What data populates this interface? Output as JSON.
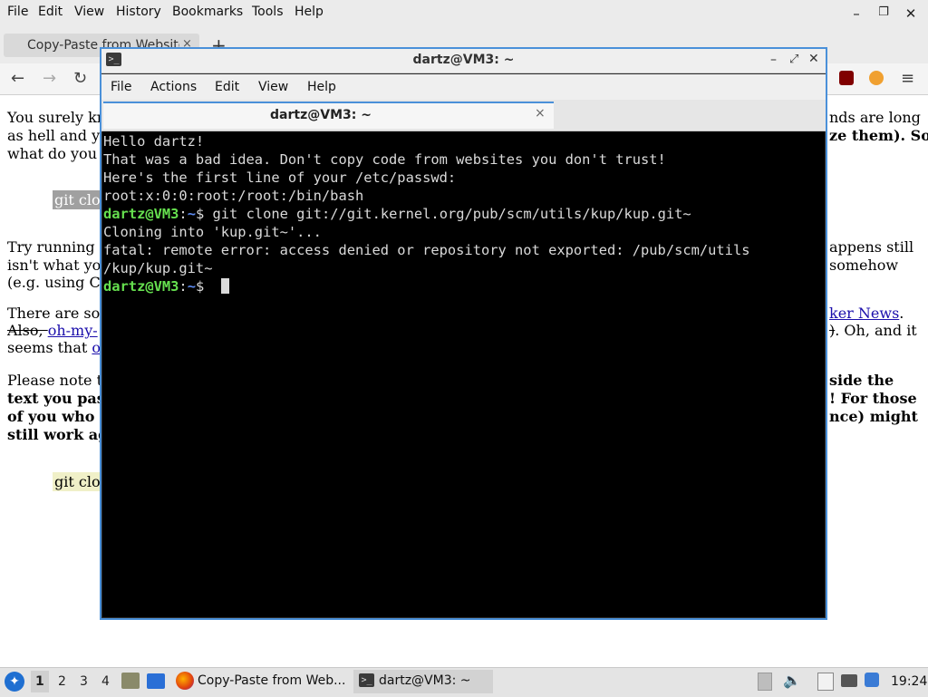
{
  "browser": {
    "menu": [
      "File",
      "Edit",
      "View",
      "History",
      "Bookmarks",
      "Tools",
      "Help"
    ],
    "tab_title": "Copy-Paste from Website",
    "tab_close": "×",
    "new_tab": "+",
    "window_buttons": {
      "minimize": "–",
      "maximize": "❐",
      "close": "✕"
    }
  },
  "page": {
    "p1": [
      "You surely kn",
      "nds are long",
      "as hell and y",
      "ze them). So,",
      "what do you "
    ],
    "code_top": "git clo",
    "p2": [
      "Try running ",
      "appens still",
      "isn't what yo",
      "somehow",
      "(e.g. using C"
    ],
    "p3": {
      "l1_left": "There are so",
      "l1_link": "ker News",
      "l1_end": ".",
      "l2_left": "Also, ",
      "l2_link": "oh-my-",
      "l2_right_strike": ")",
      "l2_right": ". Oh, and it",
      "l3_left": "seems that ",
      "l3_link": "o"
    },
    "p4": [
      "Please note t",
      "side the",
      "text you pas",
      "! For those",
      "of you who ",
      "nce) might",
      "still work ag"
    ],
    "code_bottom": "git clo"
  },
  "terminal": {
    "window_title": "dartz@VM3: ~",
    "menu": [
      "File",
      "Actions",
      "Edit",
      "View",
      "Help"
    ],
    "tab_label": "dartz@VM3: ~",
    "tab_close": "×",
    "prompt_user": "dartz@VM3",
    "prompt_sep": ":",
    "prompt_path": "~",
    "prompt_sym": "$",
    "lines": [
      "Hello dartz!",
      "That was a bad idea. Don't copy code from websites you don't trust!",
      "Here's the first line of your /etc/passwd:",
      "root:x:0:0:root:/root:/bin/bash"
    ],
    "command": " git clone git://git.kernel.org/pub/scm/utils/kup/kup.git~",
    "output": [
      "Cloning into 'kup.git~'...",
      "fatal: remote error: access denied or repository not exported: /pub/scm/utils",
      "/kup/kup.git~"
    ]
  },
  "taskbar": {
    "workspaces": [
      "1",
      "2",
      "3",
      "4"
    ],
    "task_browser": "Copy-Paste from Web...",
    "task_terminal": "dartz@VM3: ~",
    "clock": "19:24"
  },
  "colors": {
    "terminal_bg": "#000000",
    "prompt_user": "#66e04f",
    "prompt_path": "#5c8af0",
    "window_border": "#4a90d9"
  }
}
